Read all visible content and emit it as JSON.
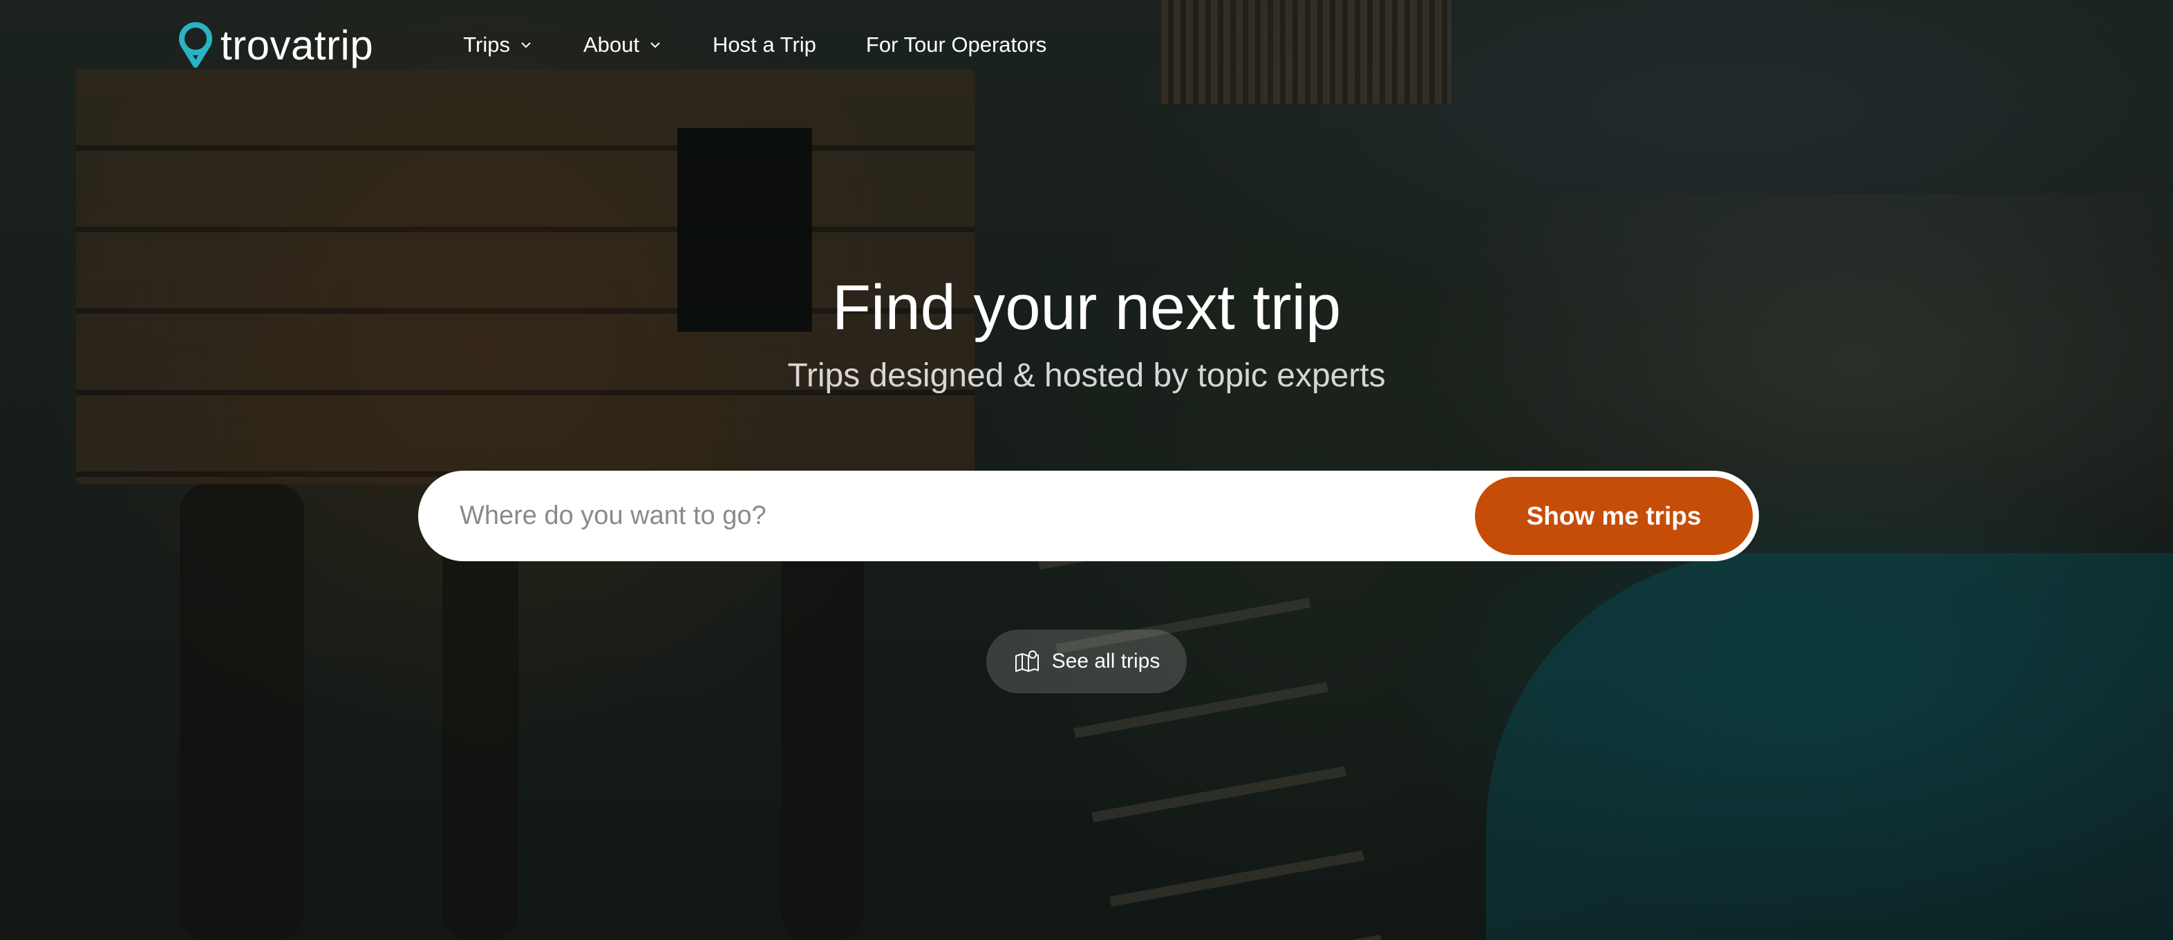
{
  "brand": {
    "name": "trovatrip",
    "accent_color": "#2bb3c4",
    "logo_icon": "map-pin-icon"
  },
  "nav": {
    "items": [
      {
        "label": "Trips",
        "has_dropdown": true
      },
      {
        "label": "About",
        "has_dropdown": true
      },
      {
        "label": "Host a Trip",
        "has_dropdown": false
      },
      {
        "label": "For Tour Operators",
        "has_dropdown": false
      }
    ]
  },
  "hero": {
    "title": "Find your next trip",
    "subtitle": "Trips designed & hosted by topic experts",
    "background_overlay": "dark"
  },
  "search": {
    "placeholder": "Where do you want to go?",
    "value": "",
    "button_label": "Show me trips",
    "button_color": "#c64d08"
  },
  "see_all": {
    "label": "See all trips",
    "icon": "map-icon"
  }
}
